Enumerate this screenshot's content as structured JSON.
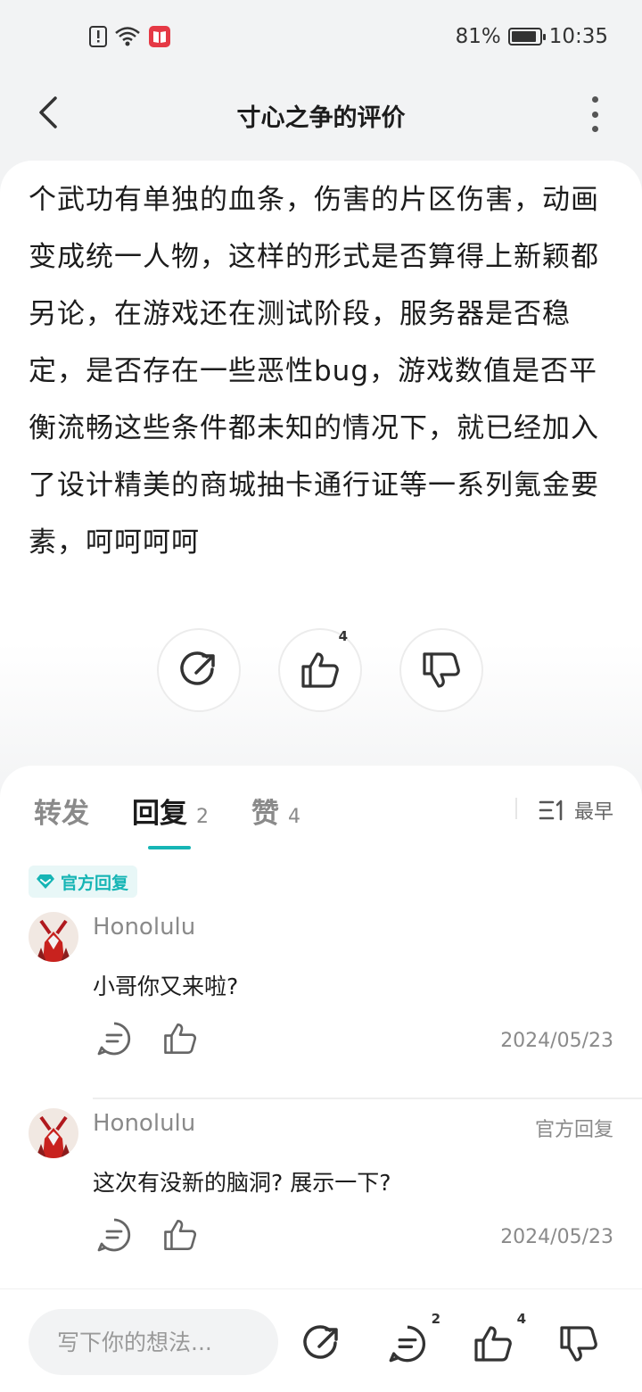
{
  "status_bar": {
    "battery": "81%",
    "battery_level": 0.81,
    "time": "10:35"
  },
  "nav": {
    "title": "寸心之争的评价",
    "back_icon": "back-arrow-icon",
    "more_icon": "more-vertical-icon"
  },
  "review": {
    "text": "个武功有单独的血条，伤害的片区伤害，动画变成统一人物，这样的形式是否算得上新颖都另论，在游戏还在测试阶段，服务器是否稳定，是否存在一些恶性bug，游戏数值是否平衡流畅这些条件都未知的情况下，就已经加入了设计精美的商城抽卡通行证等一系列氪金要素，呵呵呵呵",
    "like_count": "4"
  },
  "tabs": [
    {
      "label": "转发",
      "count": ""
    },
    {
      "label": "回复",
      "count": "2"
    },
    {
      "label": "赞",
      "count": "4"
    }
  ],
  "sort": {
    "label": "最早"
  },
  "official_tag": "官方回复",
  "replies": [
    {
      "user": "Honolulu",
      "tag": "",
      "text": "小哥你又来啦?",
      "date": "2024/05/23"
    },
    {
      "user": "Honolulu",
      "tag": "官方回复",
      "text": "这次有没新的脑洞? 展示一下?",
      "date": "2024/05/23"
    }
  ],
  "bottom_bar": {
    "placeholder": "写下你的想法...",
    "comment_count": "2",
    "like_count": "4"
  },
  "colors": {
    "accent": "#16b5b5",
    "text": "#1c1c1c",
    "muted": "#8a8a8a"
  }
}
